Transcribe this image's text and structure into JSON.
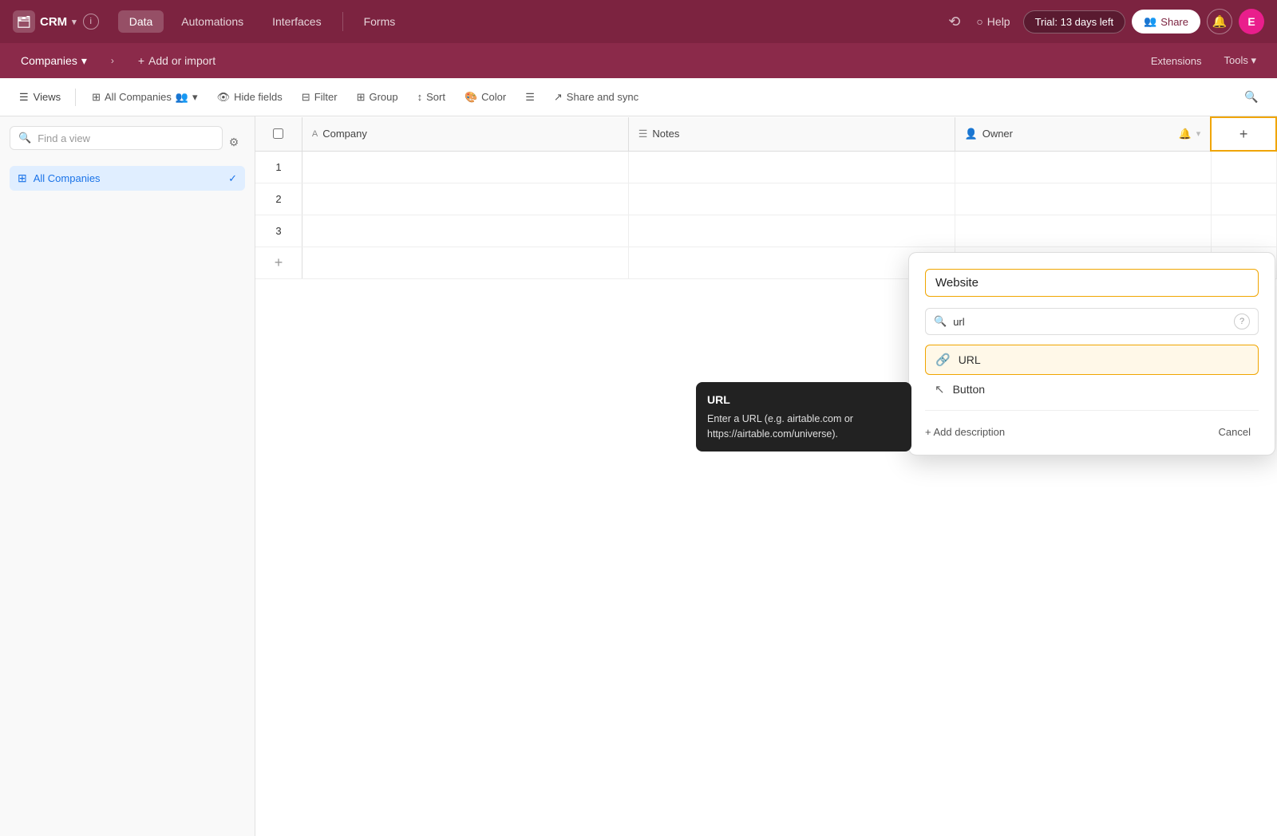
{
  "app": {
    "logo_icon": "🗂",
    "title": "CRM",
    "info_icon": "ℹ",
    "nav_tabs": [
      {
        "id": "data",
        "label": "Data",
        "active": true
      },
      {
        "id": "automations",
        "label": "Automations",
        "active": false
      },
      {
        "id": "interfaces",
        "label": "Interfaces",
        "active": false
      },
      {
        "id": "forms",
        "label": "Forms",
        "active": false
      }
    ],
    "history_icon": "⟳",
    "help_icon": "?",
    "help_label": "Help",
    "trial_label": "Trial: 13 days left",
    "share_label": "Share",
    "bell_icon": "🔔",
    "avatar_label": "E"
  },
  "subnav": {
    "companies_label": "Companies",
    "chevron_icon": "▾",
    "chevron_right_icon": ">",
    "add_label": "Add or import",
    "extensions_label": "Extensions",
    "tools_label": "Tools"
  },
  "toolbar": {
    "views_icon": "≡",
    "views_label": "Views",
    "all_companies_label": "All Companies",
    "people_icon": "👥",
    "dropdown_icon": "▾",
    "hide_fields_icon": "👁",
    "hide_fields_label": "Hide fields",
    "filter_icon": "⊟",
    "filter_label": "Filter",
    "group_icon": "⊞",
    "group_label": "Group",
    "sort_icon": "↕",
    "sort_label": "Sort",
    "color_icon": "🎨",
    "color_label": "Color",
    "row_height_icon": "☰",
    "share_sync_icon": "↗",
    "share_sync_label": "Share and sync",
    "search_icon": "🔍"
  },
  "sidebar": {
    "search_placeholder": "Find a view",
    "gear_icon": "⚙",
    "views": [
      {
        "id": "all-companies",
        "icon": "⊞",
        "label": "All Companies",
        "active": true
      }
    ]
  },
  "grid": {
    "columns": [
      {
        "id": "company",
        "icon": "A",
        "label": "Company"
      },
      {
        "id": "notes",
        "icon": "≡",
        "label": "Notes"
      },
      {
        "id": "owner",
        "icon": "👤",
        "label": "Owner"
      }
    ],
    "rows": [
      {
        "num": 1,
        "company": "",
        "notes": "",
        "owner": ""
      },
      {
        "num": 2,
        "company": "",
        "notes": "",
        "owner": ""
      },
      {
        "num": 3,
        "company": "",
        "notes": "",
        "owner": ""
      }
    ],
    "add_row_icon": "+",
    "add_col_icon": "+"
  },
  "dropdown": {
    "field_name": "Website",
    "search_placeholder": "url",
    "search_icon": "🔍",
    "help_icon": "?",
    "items": [
      {
        "id": "url",
        "icon": "🔗",
        "label": "URL",
        "selected": true
      },
      {
        "id": "button",
        "icon": "↖",
        "label": "Button",
        "selected": false
      }
    ],
    "add_description_label": "+ Add description",
    "cancel_label": "Cancel"
  },
  "tooltip": {
    "title": "URL",
    "description": "Enter a URL (e.g. airtable.com or https://airtable.com/universe)."
  }
}
